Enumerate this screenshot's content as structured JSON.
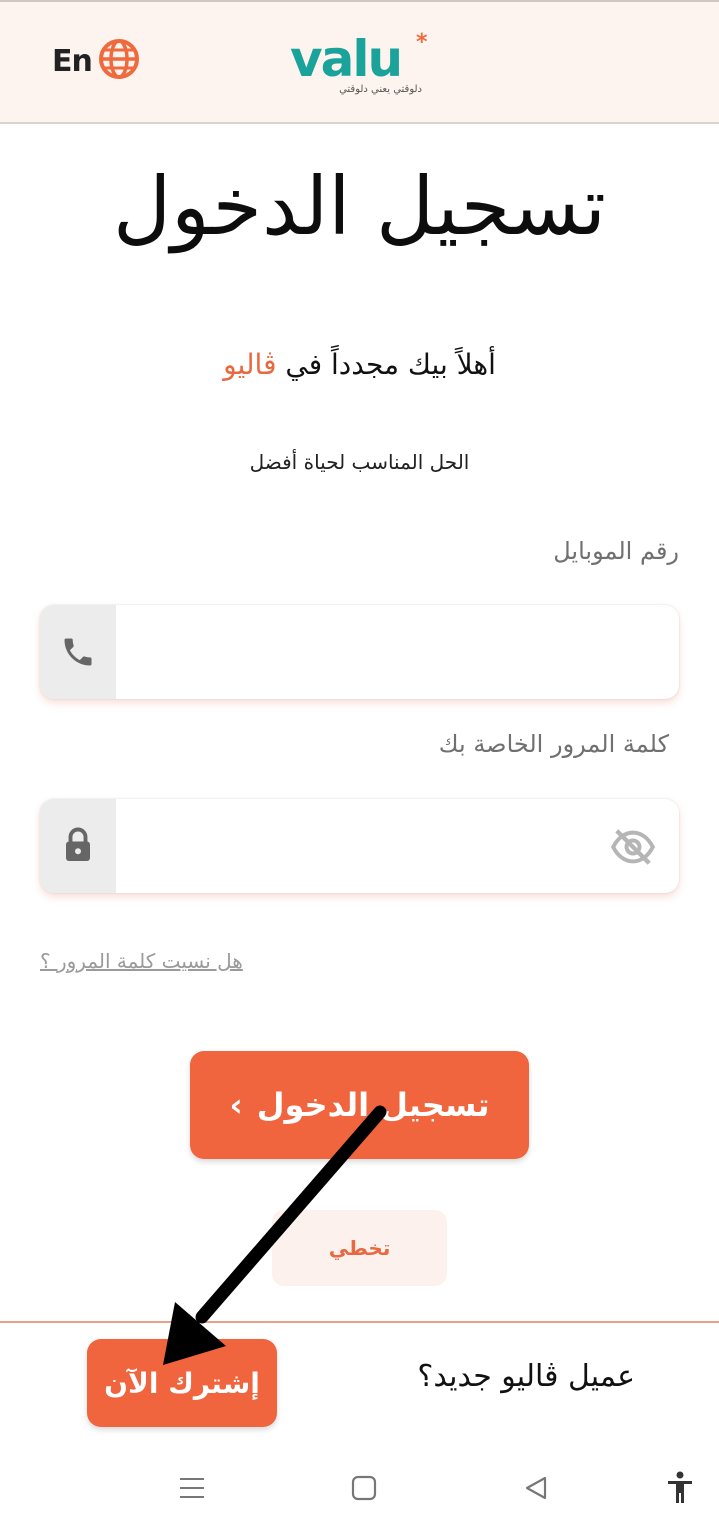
{
  "header": {
    "lang_label": "En",
    "logo_word": "valu",
    "logo_star": "*",
    "logo_tagline": "دلوقتي يعني دلوقتي"
  },
  "page": {
    "title": "تسجيل الدخول",
    "welcome_prefix": "أهلاً بيك مجدداً في ",
    "welcome_brand": "ڤاليو",
    "tagline": "الحل المناسب لحياة أفضل"
  },
  "form": {
    "mobile_label": "رقم الموبايل",
    "mobile_value": "",
    "password_label": "كلمة المرور الخاصة بك",
    "password_value": "",
    "forgot_link": "هل نسيت كلمة المرور ؟",
    "login_label": "تسجيل الدخول",
    "login_chevron": "›",
    "skip_label": "تخطي"
  },
  "footer": {
    "new_customer": "عميل ڤاليو جديد؟",
    "signup_label": "إشترك الآن"
  },
  "colors": {
    "accent": "#f0643e",
    "brand_teal": "#1aa39a",
    "header_bg": "#fdf3ef"
  },
  "icons": {
    "language": "globe-icon",
    "mobile": "phone-icon",
    "password": "lock-icon",
    "visibility": "eye-off-icon",
    "nav_menu": "menu-icon",
    "nav_home": "square-icon",
    "nav_back": "triangle-back-icon",
    "accessibility": "accessibility-icon"
  }
}
